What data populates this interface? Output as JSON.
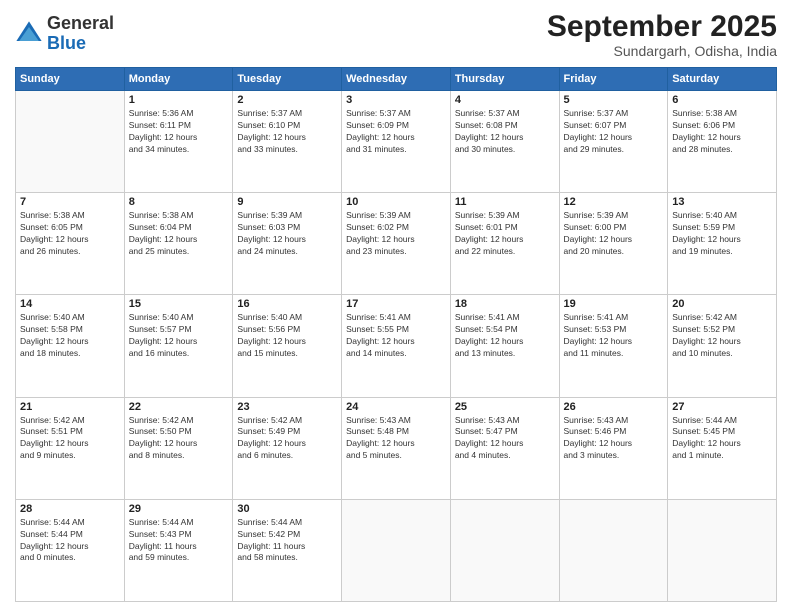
{
  "logo": {
    "general": "General",
    "blue": "Blue"
  },
  "header": {
    "month": "September 2025",
    "location": "Sundargarh, Odisha, India"
  },
  "days_of_week": [
    "Sunday",
    "Monday",
    "Tuesday",
    "Wednesday",
    "Thursday",
    "Friday",
    "Saturday"
  ],
  "weeks": [
    [
      {
        "day": "",
        "info": ""
      },
      {
        "day": "1",
        "info": "Sunrise: 5:36 AM\nSunset: 6:11 PM\nDaylight: 12 hours\nand 34 minutes."
      },
      {
        "day": "2",
        "info": "Sunrise: 5:37 AM\nSunset: 6:10 PM\nDaylight: 12 hours\nand 33 minutes."
      },
      {
        "day": "3",
        "info": "Sunrise: 5:37 AM\nSunset: 6:09 PM\nDaylight: 12 hours\nand 31 minutes."
      },
      {
        "day": "4",
        "info": "Sunrise: 5:37 AM\nSunset: 6:08 PM\nDaylight: 12 hours\nand 30 minutes."
      },
      {
        "day": "5",
        "info": "Sunrise: 5:37 AM\nSunset: 6:07 PM\nDaylight: 12 hours\nand 29 minutes."
      },
      {
        "day": "6",
        "info": "Sunrise: 5:38 AM\nSunset: 6:06 PM\nDaylight: 12 hours\nand 28 minutes."
      }
    ],
    [
      {
        "day": "7",
        "info": "Sunrise: 5:38 AM\nSunset: 6:05 PM\nDaylight: 12 hours\nand 26 minutes."
      },
      {
        "day": "8",
        "info": "Sunrise: 5:38 AM\nSunset: 6:04 PM\nDaylight: 12 hours\nand 25 minutes."
      },
      {
        "day": "9",
        "info": "Sunrise: 5:39 AM\nSunset: 6:03 PM\nDaylight: 12 hours\nand 24 minutes."
      },
      {
        "day": "10",
        "info": "Sunrise: 5:39 AM\nSunset: 6:02 PM\nDaylight: 12 hours\nand 23 minutes."
      },
      {
        "day": "11",
        "info": "Sunrise: 5:39 AM\nSunset: 6:01 PM\nDaylight: 12 hours\nand 22 minutes."
      },
      {
        "day": "12",
        "info": "Sunrise: 5:39 AM\nSunset: 6:00 PM\nDaylight: 12 hours\nand 20 minutes."
      },
      {
        "day": "13",
        "info": "Sunrise: 5:40 AM\nSunset: 5:59 PM\nDaylight: 12 hours\nand 19 minutes."
      }
    ],
    [
      {
        "day": "14",
        "info": "Sunrise: 5:40 AM\nSunset: 5:58 PM\nDaylight: 12 hours\nand 18 minutes."
      },
      {
        "day": "15",
        "info": "Sunrise: 5:40 AM\nSunset: 5:57 PM\nDaylight: 12 hours\nand 16 minutes."
      },
      {
        "day": "16",
        "info": "Sunrise: 5:40 AM\nSunset: 5:56 PM\nDaylight: 12 hours\nand 15 minutes."
      },
      {
        "day": "17",
        "info": "Sunrise: 5:41 AM\nSunset: 5:55 PM\nDaylight: 12 hours\nand 14 minutes."
      },
      {
        "day": "18",
        "info": "Sunrise: 5:41 AM\nSunset: 5:54 PM\nDaylight: 12 hours\nand 13 minutes."
      },
      {
        "day": "19",
        "info": "Sunrise: 5:41 AM\nSunset: 5:53 PM\nDaylight: 12 hours\nand 11 minutes."
      },
      {
        "day": "20",
        "info": "Sunrise: 5:42 AM\nSunset: 5:52 PM\nDaylight: 12 hours\nand 10 minutes."
      }
    ],
    [
      {
        "day": "21",
        "info": "Sunrise: 5:42 AM\nSunset: 5:51 PM\nDaylight: 12 hours\nand 9 minutes."
      },
      {
        "day": "22",
        "info": "Sunrise: 5:42 AM\nSunset: 5:50 PM\nDaylight: 12 hours\nand 8 minutes."
      },
      {
        "day": "23",
        "info": "Sunrise: 5:42 AM\nSunset: 5:49 PM\nDaylight: 12 hours\nand 6 minutes."
      },
      {
        "day": "24",
        "info": "Sunrise: 5:43 AM\nSunset: 5:48 PM\nDaylight: 12 hours\nand 5 minutes."
      },
      {
        "day": "25",
        "info": "Sunrise: 5:43 AM\nSunset: 5:47 PM\nDaylight: 12 hours\nand 4 minutes."
      },
      {
        "day": "26",
        "info": "Sunrise: 5:43 AM\nSunset: 5:46 PM\nDaylight: 12 hours\nand 3 minutes."
      },
      {
        "day": "27",
        "info": "Sunrise: 5:44 AM\nSunset: 5:45 PM\nDaylight: 12 hours\nand 1 minute."
      }
    ],
    [
      {
        "day": "28",
        "info": "Sunrise: 5:44 AM\nSunset: 5:44 PM\nDaylight: 12 hours\nand 0 minutes."
      },
      {
        "day": "29",
        "info": "Sunrise: 5:44 AM\nSunset: 5:43 PM\nDaylight: 11 hours\nand 59 minutes."
      },
      {
        "day": "30",
        "info": "Sunrise: 5:44 AM\nSunset: 5:42 PM\nDaylight: 11 hours\nand 58 minutes."
      },
      {
        "day": "",
        "info": ""
      },
      {
        "day": "",
        "info": ""
      },
      {
        "day": "",
        "info": ""
      },
      {
        "day": "",
        "info": ""
      }
    ]
  ]
}
